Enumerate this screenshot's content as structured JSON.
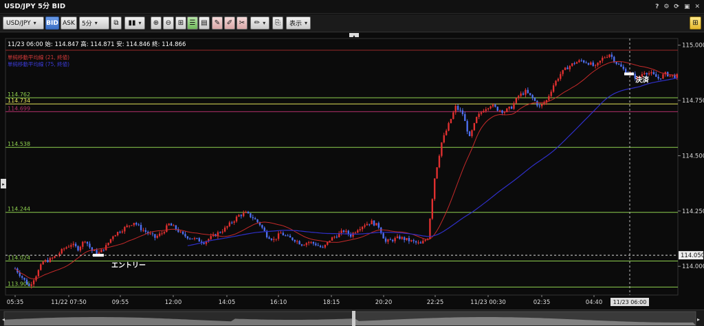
{
  "window": {
    "title": "USD/JPY 5分 BID"
  },
  "toolbar": {
    "symbol": "USD/JPY",
    "bid_label": "BID",
    "ask_label": "ASK",
    "timeframe": "5分",
    "display_label": "表示"
  },
  "header": {
    "ohlc_text": "11/23 06:00  始: 114.847  高: 114.871  安: 114.846  終: 114.866",
    "ma_short_label": "単純移動平均線 (21, 終値)",
    "ma_long_label": "単純移動平均線 (75, 終値)"
  },
  "annotations": {
    "entry": "エントリー",
    "exit": "決済"
  },
  "crosshair": {
    "time_label": "11/23 06:00",
    "price_label": "114.050"
  },
  "chart_data": {
    "type": "candlestick",
    "title": "USD/JPY 5分 BID",
    "y_axis": {
      "range": [
        113.87,
        115.03
      ],
      "ticks": [
        "115.000",
        "114.750",
        "114.500",
        "114.250",
        "114.000"
      ]
    },
    "x_axis": {
      "ticks": [
        "05:35",
        "11/22 07:50",
        "09:55",
        "12:00",
        "14:05",
        "16:10",
        "18:15",
        "20:20",
        "22:25",
        "11/23 00:30",
        "02:35",
        "04:40"
      ]
    },
    "hlines": [
      {
        "label": "114.762",
        "value": 114.762,
        "color": "#8fd14f"
      },
      {
        "label": "114.734",
        "value": 114.734,
        "color": "#e6e65a"
      },
      {
        "label": "114.699",
        "value": 114.699,
        "color": "#b0306a"
      },
      {
        "label": "114.538",
        "value": 114.538,
        "color": "#8fd14f"
      },
      {
        "label": "114.244",
        "value": 114.244,
        "color": "#8fd14f"
      },
      {
        "label": "114.024",
        "value": 114.024,
        "color": "#8fd14f"
      },
      {
        "label": "113.906",
        "value": 113.906,
        "color": "#8fd14f"
      },
      {
        "label": "",
        "value": 114.977,
        "color": "#9a2a2a"
      }
    ],
    "close_path": [
      113.99,
      113.95,
      113.91,
      113.96,
      114.02,
      114.03,
      114.05,
      114.08,
      114.1,
      114.08,
      114.12,
      114.07,
      114.06,
      114.09,
      114.14,
      114.16,
      114.18,
      114.2,
      114.17,
      114.15,
      114.13,
      114.15,
      114.19,
      114.17,
      114.14,
      114.13,
      114.12,
      114.11,
      114.13,
      114.15,
      114.17,
      114.2,
      114.23,
      114.24,
      114.22,
      114.19,
      114.14,
      114.12,
      114.15,
      114.13,
      114.12,
      114.1,
      114.11,
      114.1,
      114.08,
      114.12,
      114.14,
      114.16,
      114.14,
      114.17,
      114.19,
      114.2,
      114.18,
      114.11,
      114.12,
      114.13,
      114.12,
      114.11,
      114.1,
      114.13,
      114.4,
      114.56,
      114.64,
      114.72,
      114.69,
      114.58,
      114.67,
      114.71,
      114.73,
      114.71,
      114.7,
      114.72,
      114.77,
      114.79,
      114.76,
      114.72,
      114.75,
      114.82,
      114.87,
      114.9,
      114.92,
      114.93,
      114.92,
      114.9,
      114.94,
      114.96,
      114.92,
      114.89,
      114.87,
      114.85,
      114.88,
      114.87,
      114.85,
      114.87,
      114.86
    ]
  }
}
